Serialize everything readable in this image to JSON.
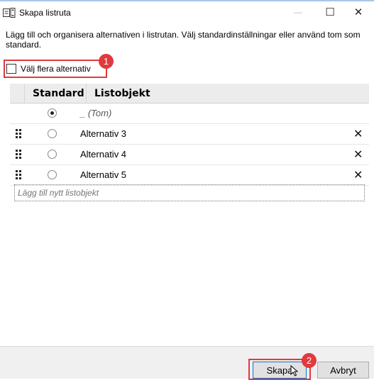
{
  "window": {
    "title": "Skapa listruta",
    "app_icon": "combo-box-icon",
    "minimize_glyph": "—",
    "maximize_glyph": "☐",
    "close_glyph": "✕"
  },
  "description": "Lägg till och organisera alternativen i listrutan. Välj standardinställningar eller använd tom som standard.",
  "multi_select": {
    "label": "Välj flera alternativ",
    "checked": false
  },
  "table": {
    "columns": [
      "Standard",
      "Listobjekt"
    ],
    "rows": [
      {
        "text": "_ (Tom)",
        "default": true,
        "draggable": false,
        "deletable": false
      },
      {
        "text": "Alternativ 3",
        "default": false,
        "draggable": true,
        "deletable": true
      },
      {
        "text": "Alternativ 4",
        "default": false,
        "draggable": true,
        "deletable": true
      },
      {
        "text": "Alternativ 5",
        "default": false,
        "draggable": true,
        "deletable": true
      }
    ],
    "delete_glyph": "✕",
    "new_item_placeholder": "Lägg till nytt listobjekt"
  },
  "annotations": {
    "badge_1": "1",
    "badge_2": "2",
    "highlight_color": "#e0393e"
  },
  "buttons": {
    "create": "Skapa",
    "cancel": "Avbryt"
  }
}
